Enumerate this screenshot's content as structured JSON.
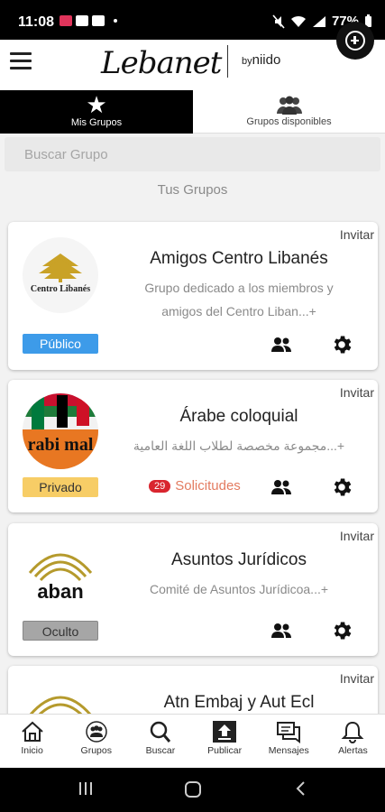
{
  "status_bar": {
    "time": "11:08",
    "battery": "77%"
  },
  "header": {
    "logo_text": "Lebanet",
    "by_text": "by",
    "brand_text": "niido"
  },
  "tabs": [
    {
      "label": "Mis Grupos",
      "icon": "star-icon",
      "active": true
    },
    {
      "label": "Grupos disponibles",
      "icon": "group-icon",
      "active": false
    }
  ],
  "search": {
    "placeholder": "Buscar Grupo"
  },
  "section_title": "Tus Grupos",
  "groups": [
    {
      "name": "Amigos Centro Libanés",
      "description_line1": "Grupo dedicado a los miembros y",
      "description_line2": "amigos del Centro Liban...+",
      "privacy": "Público",
      "invite": "Invitar",
      "avatar_text": "Centro Libanés"
    },
    {
      "name": "Árabe coloquial",
      "description_line1": "مجموعة مخصصة لطلاب اللغة العامية...+",
      "privacy": "Privado",
      "invite": "Invitar",
      "requests_count": "29",
      "requests_label": "Solicitudes",
      "avatar_text": "rabi mal"
    },
    {
      "name": "Asuntos Jurídicos",
      "description_line1": "Comité de Asuntos Jurídicoa...+",
      "privacy": "Oculto",
      "invite": "Invitar",
      "avatar_text": "aban"
    },
    {
      "name": "Atn Embaj y Aut Ecl",
      "invite": "Invitar"
    }
  ],
  "bottom_nav": [
    {
      "label": "Inicio",
      "icon": "home-icon"
    },
    {
      "label": "Grupos",
      "icon": "groups-icon"
    },
    {
      "label": "Buscar",
      "icon": "search-icon"
    },
    {
      "label": "Publicar",
      "icon": "publish-icon"
    },
    {
      "label": "Mensajes",
      "icon": "messages-icon"
    },
    {
      "label": "Alertas",
      "icon": "bell-icon"
    }
  ],
  "colors": {
    "public": "#3d9be9",
    "private": "#f7cd66",
    "hidden": "#a6a6a6",
    "requests": "#e37b60",
    "requests_badge": "#d9252e"
  }
}
